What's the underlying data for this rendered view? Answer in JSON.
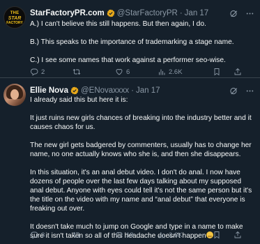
{
  "tweets": [
    {
      "avatar": {
        "line1": "THE",
        "line2": "STAR",
        "line3": "FACTORY"
      },
      "name": "StarFactoryPR.com",
      "handle": "@StarFactoryPR",
      "dot": "·",
      "time": "Jan 17",
      "paragraphs": [
        "A.) I can't believe this still happens. But then again, I do.",
        "B.) This speaks to the importance of trademarking a stage name.",
        "C.) I see some names that work against a performer seo-wise."
      ],
      "stats": {
        "replies": "2",
        "retweets": "",
        "likes": "6",
        "views": "2.6K"
      }
    },
    {
      "name": "Ellie Nova",
      "handle": "@ENovaxxxx",
      "dot": "·",
      "time": "Jan 17",
      "paragraphs": [
        "I already said this but here it is:",
        "It just ruins new girls chances of breaking into the industry better and it causes chaos for us.",
        "The new girl gets badgered by commenters, usually has to change her name, no one actually knows who she is, and then she disappears.",
        "In this situation, it's an anal debut video. I don't do anal. I now have dozens of people over the last few days talking about my supposed anal debut. Anyone with eyes could tell it's not the same person but it's the title on the video with my name and “anal debut” that everyone is freaking out over.",
        "It doesn't take much to jump on Google and type in a name to make sure it isn't taken so all of this headache doesn't happen"
      ],
      "stats": {
        "replies": "3",
        "retweets": "",
        "likes": "18",
        "views": "2.6K"
      }
    }
  ],
  "colors": {
    "background": "#15202b",
    "text": "#f7f9f9",
    "muted": "#8b98a5",
    "verified": "#e8a91a",
    "divider": "#38444d"
  }
}
